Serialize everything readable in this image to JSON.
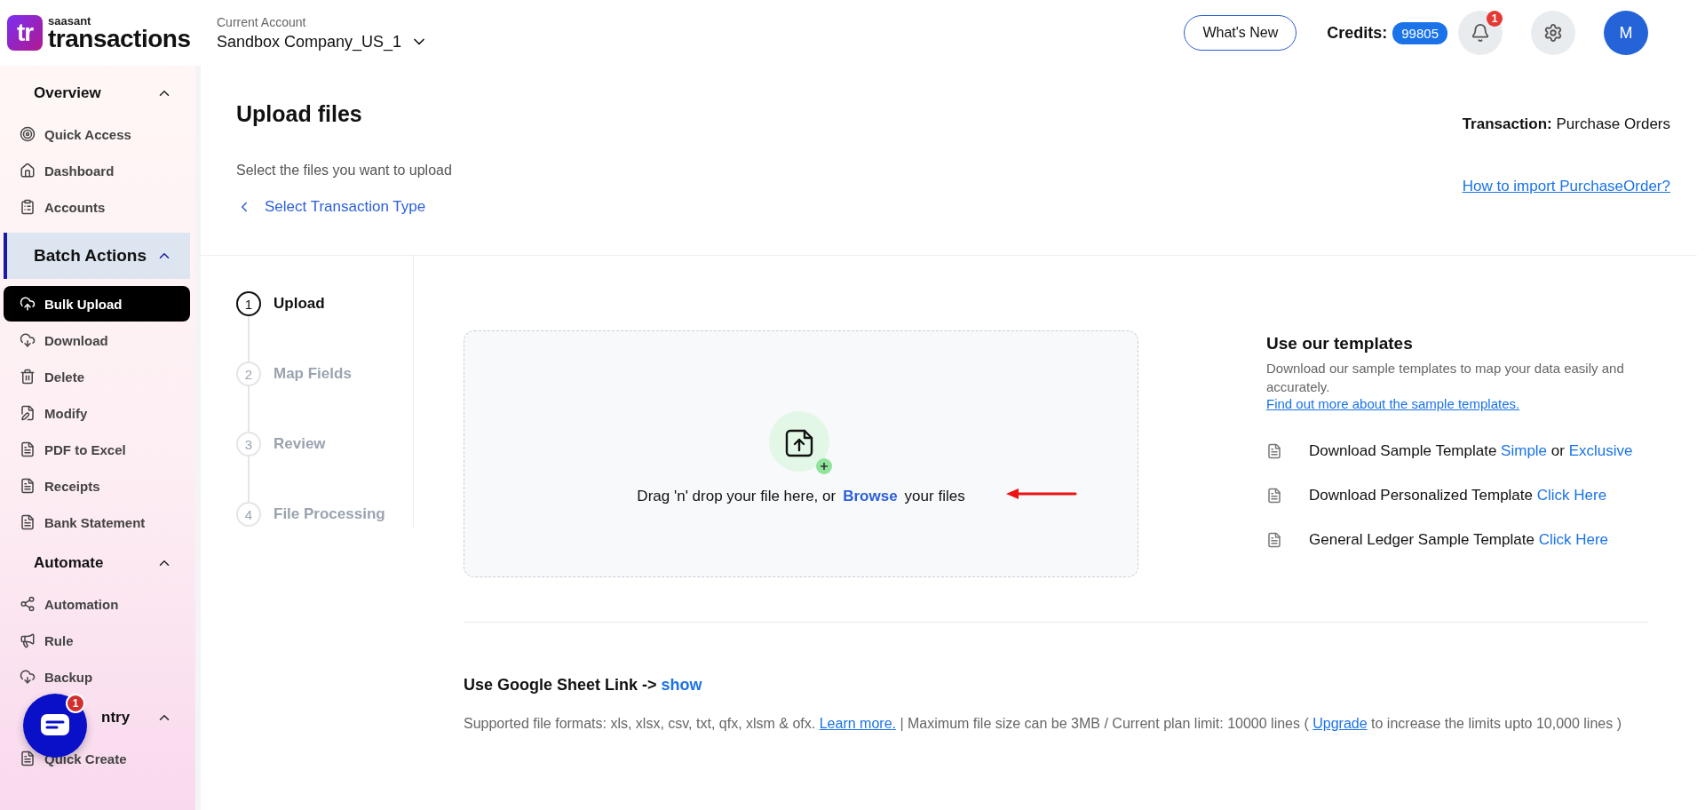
{
  "brand": {
    "mark": "tr",
    "small": "saasant",
    "name": "transactions"
  },
  "account": {
    "label": "Current Account",
    "value": "Sandbox Company_US_1"
  },
  "header": {
    "whats_new": "What's New",
    "credits_label": "Credits:",
    "credits": "99805",
    "notification_count": "1",
    "avatar": "M"
  },
  "sidebar": {
    "sections": [
      {
        "title": "Overview",
        "expanded": true,
        "selected": false,
        "items": [
          {
            "label": "Quick Access",
            "selected": false
          },
          {
            "label": "Dashboard",
            "selected": false
          },
          {
            "label": "Accounts",
            "selected": false
          }
        ]
      },
      {
        "title": "Batch Actions",
        "expanded": true,
        "selected": true,
        "items": [
          {
            "label": "Bulk Upload",
            "selected": true
          },
          {
            "label": "Download",
            "selected": false
          },
          {
            "label": "Delete",
            "selected": false
          },
          {
            "label": "Modify",
            "selected": false
          },
          {
            "label": "PDF to Excel",
            "selected": false
          },
          {
            "label": "Receipts",
            "selected": false
          },
          {
            "label": "Bank Statement",
            "selected": false
          }
        ]
      },
      {
        "title": "Automate",
        "expanded": true,
        "selected": false,
        "items": [
          {
            "label": "Automation",
            "selected": false
          },
          {
            "label": "Rule",
            "selected": false
          },
          {
            "label": "Backup",
            "selected": false
          }
        ]
      },
      {
        "title": "ntry",
        "expanded": true,
        "selected": false,
        "items": [
          {
            "label": "Quick Create",
            "selected": false
          }
        ]
      }
    ]
  },
  "chat": {
    "badge": "1"
  },
  "page": {
    "title": "Upload files",
    "subtitle": "Select the files you want to upload",
    "back_link": "Select Transaction Type",
    "transaction_label": "Transaction:",
    "transaction_value": "Purchase Orders",
    "help_link": "How to import PurchaseOrder?"
  },
  "steps": [
    {
      "number": "1",
      "label": "Upload",
      "selected": true
    },
    {
      "number": "2",
      "label": "Map Fields",
      "selected": false
    },
    {
      "number": "3",
      "label": "Review",
      "selected": false
    },
    {
      "number": "4",
      "label": "File Processing",
      "selected": false
    }
  ],
  "dropzone": {
    "text_before": "Drag 'n' drop your file here, or",
    "browse": "Browse",
    "text_after": "your files"
  },
  "templates": {
    "title": "Use our templates",
    "description": "Download our sample templates to map your data easily and accurately.",
    "more_link": "Find out more about the sample templates.",
    "rows": [
      [
        {
          "kind": "text",
          "text": "Download Sample Template"
        },
        {
          "kind": "link",
          "text": "Simple"
        },
        {
          "kind": "text",
          "text": "or"
        },
        {
          "kind": "link",
          "text": "Exclusive"
        }
      ],
      [
        {
          "kind": "text",
          "text": "Download Personalized Template"
        },
        {
          "kind": "link",
          "text": "Click Here"
        }
      ],
      [
        {
          "kind": "text",
          "text": "General Ledger Sample Template"
        },
        {
          "kind": "link",
          "text": "Click Here"
        }
      ]
    ]
  },
  "google_sheet": {
    "label": "Use Google Sheet Link ->",
    "link": "show"
  },
  "note": [
    {
      "kind": "text",
      "text": "Supported file formats: xls, xlsx, csv, txt, qfx, xlsm & ofx."
    },
    {
      "kind": "link",
      "text": "Learn more."
    },
    {
      "kind": "text",
      "text": "|  Maximum file size can be 3MB / Current plan limit: 10000 lines ("
    },
    {
      "kind": "link",
      "text": "Upgrade"
    },
    {
      "kind": "text",
      "text": "to increase the limits upto 10,000 lines )"
    }
  ]
}
